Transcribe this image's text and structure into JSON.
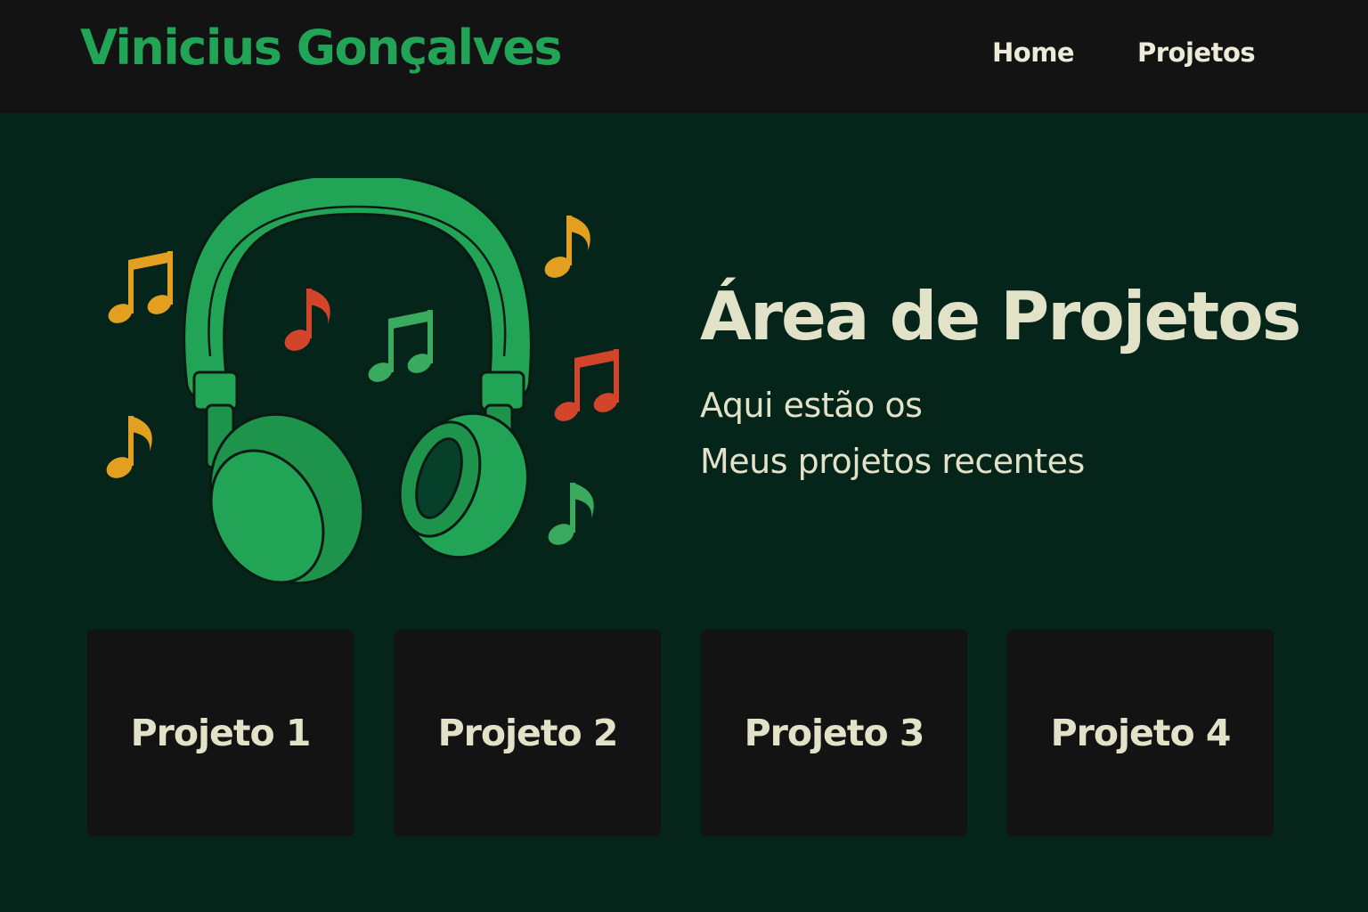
{
  "header": {
    "brand": "Vinicius Gonçalves",
    "nav": [
      {
        "label": "Home"
      },
      {
        "label": "Projetos"
      }
    ]
  },
  "hero": {
    "title": "Área de Projetos",
    "subtitle_line_1": "Aqui estão os",
    "subtitle_line_2": "Meus projetos recentes",
    "illustration": {
      "icon": "headphones-icon",
      "notes": [
        "music-note-icon"
      ]
    }
  },
  "projects": [
    {
      "label": "Projeto 1"
    },
    {
      "label": "Projeto 2"
    },
    {
      "label": "Projeto 3"
    },
    {
      "label": "Projeto 4"
    }
  ],
  "colors": {
    "background": "#05241a",
    "header_background": "#131313",
    "brand_green": "#22a456",
    "text_light": "#e2e2c8",
    "card_background": "#131313",
    "note_yellow": "#e3a020",
    "note_red": "#d2452a",
    "note_green": "#3aaa5e"
  }
}
